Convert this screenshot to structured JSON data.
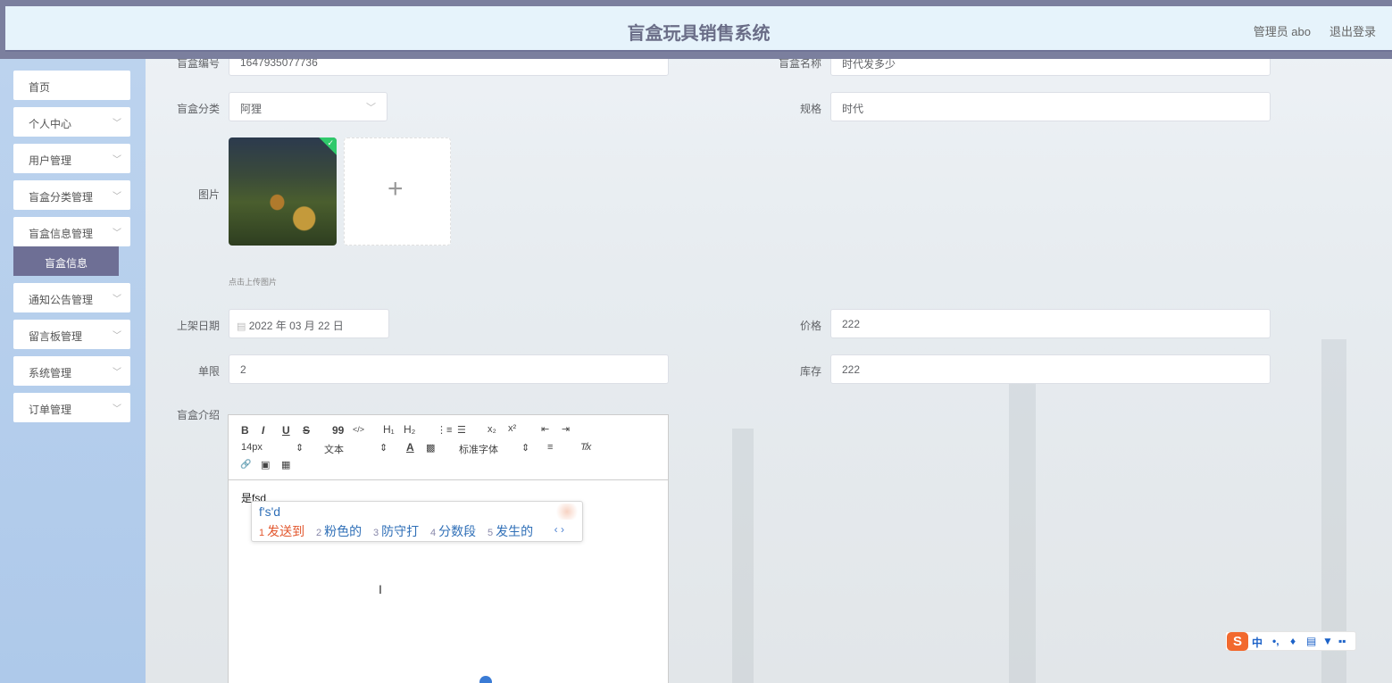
{
  "header": {
    "title": "盲盒玩具销售系统",
    "user": "管理员 abo",
    "logout": "退出登录"
  },
  "sidebar": {
    "items": [
      {
        "label": "首页"
      },
      {
        "label": "个人中心"
      },
      {
        "label": "用户管理"
      },
      {
        "label": "盲盒分类管理"
      },
      {
        "label": "盲盒信息管理"
      },
      {
        "label": "通知公告管理"
      },
      {
        "label": "留言板管理"
      },
      {
        "label": "系统管理"
      },
      {
        "label": "订单管理"
      }
    ],
    "active_sub": "盲盒信息"
  },
  "form": {
    "code_label": "盲盒编号",
    "code_value": "1647935077736",
    "name_label": "盲盒名称",
    "name_value": "时代发多少",
    "category_label": "盲盒分类",
    "category_value": "阿狸",
    "spec_label": "规格",
    "spec_value": "时代",
    "image_label": "图片",
    "upload_hint": "点击上传图片",
    "date_label": "上架日期",
    "date_value": "2022 年 03 月 22 日",
    "price_label": "价格",
    "price_value": "222",
    "limit_label": "单限",
    "limit_value": "2",
    "stock_label": "库存",
    "stock_value": "222",
    "intro_label": "盲盒介绍"
  },
  "editor": {
    "toolbar": {
      "bold": "B",
      "italic": "I",
      "underline": "U",
      "strike": "S",
      "quote": "99",
      "code": "</>",
      "h1": "H₁",
      "h2": "H₂",
      "ol": "⋮≡",
      "ul": "☰",
      "sub": "x₂",
      "sup": "x²",
      "outdent": "⇤",
      "indent": "⇥",
      "size": "14px",
      "size_arrow": "⇕",
      "type": "文本",
      "type_arrow": "⇕",
      "color": "A",
      "bg": "▩",
      "font": "标准字体",
      "font_arrow": "⇕",
      "align": "≡",
      "clean": "T̸x",
      "link": "🔗",
      "image": "▣",
      "video": "▦"
    },
    "content": "是fsd"
  },
  "ime": {
    "composition": "f's'd",
    "candidates": [
      {
        "num": "1",
        "text": "发送到"
      },
      {
        "num": "2",
        "text": "粉色的"
      },
      {
        "num": "3",
        "text": "防守打"
      },
      {
        "num": "4",
        "text": "分数段"
      },
      {
        "num": "5",
        "text": "发生的"
      }
    ],
    "nav": "‹ ›",
    "bar": {
      "logo": "S",
      "icons": [
        "中",
        "•,",
        "♦",
        "▤",
        "▼",
        "▪▪"
      ]
    }
  }
}
